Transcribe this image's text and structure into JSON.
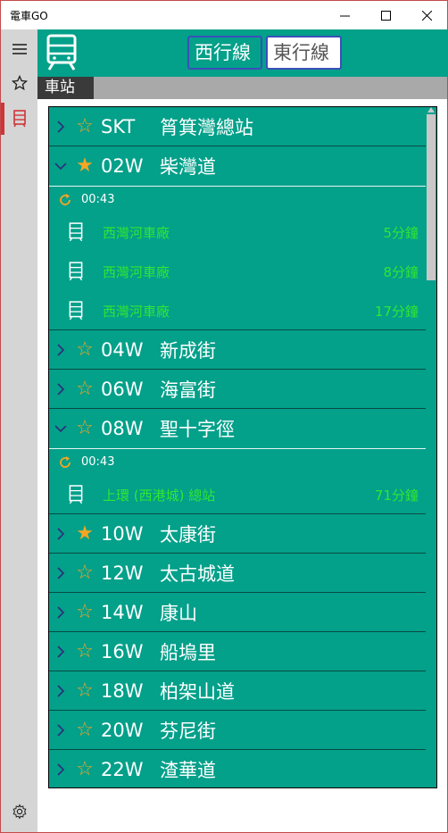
{
  "app": {
    "title": "電車GO"
  },
  "window_controls": {
    "minimize": "—",
    "maximize": "☐",
    "close": "✕"
  },
  "rail": {
    "menu_icon": "hamburger-icon",
    "favorites_icon": "star-outline-icon",
    "stations_icon": "tram-icon",
    "settings_icon": "gear-icon"
  },
  "header": {
    "logo_icon": "tram-icon",
    "west_label": "西行線",
    "east_label": "東行線",
    "active_direction": "west"
  },
  "section": {
    "label": "車站"
  },
  "colors": {
    "accent": "#03a08a",
    "star": "#f5a623",
    "eta": "#32e632",
    "rail_selected": "#d13438"
  },
  "stations": [
    {
      "code": "SKT",
      "name": "筲箕灣總站",
      "favorite": false,
      "expanded": false
    },
    {
      "code": "02W",
      "name": "柴灣道",
      "favorite": true,
      "expanded": true,
      "updated": "00:43",
      "arrivals": [
        {
          "destination": "西灣河車廠",
          "eta": "5分鐘"
        },
        {
          "destination": "西灣河車廠",
          "eta": "8分鐘"
        },
        {
          "destination": "西灣河車廠",
          "eta": "17分鐘"
        }
      ]
    },
    {
      "code": "04W",
      "name": "新成街",
      "favorite": false,
      "expanded": false
    },
    {
      "code": "06W",
      "name": "海富街",
      "favorite": false,
      "expanded": false
    },
    {
      "code": "08W",
      "name": "聖十字徑",
      "favorite": false,
      "expanded": true,
      "updated": "00:43",
      "arrivals": [
        {
          "destination": "上環 (西港城) 總站",
          "eta": "71分鐘"
        }
      ]
    },
    {
      "code": "10W",
      "name": "太康街",
      "favorite": true,
      "expanded": false
    },
    {
      "code": "12W",
      "name": "太古城道",
      "favorite": false,
      "expanded": false
    },
    {
      "code": "14W",
      "name": "康山",
      "favorite": false,
      "expanded": false
    },
    {
      "code": "16W",
      "name": "船塢里",
      "favorite": false,
      "expanded": false
    },
    {
      "code": "18W",
      "name": "柏架山道",
      "favorite": false,
      "expanded": false
    },
    {
      "code": "20W",
      "name": "芬尼街",
      "favorite": false,
      "expanded": false
    },
    {
      "code": "22W",
      "name": "渣華道",
      "favorite": false,
      "expanded": false
    }
  ]
}
